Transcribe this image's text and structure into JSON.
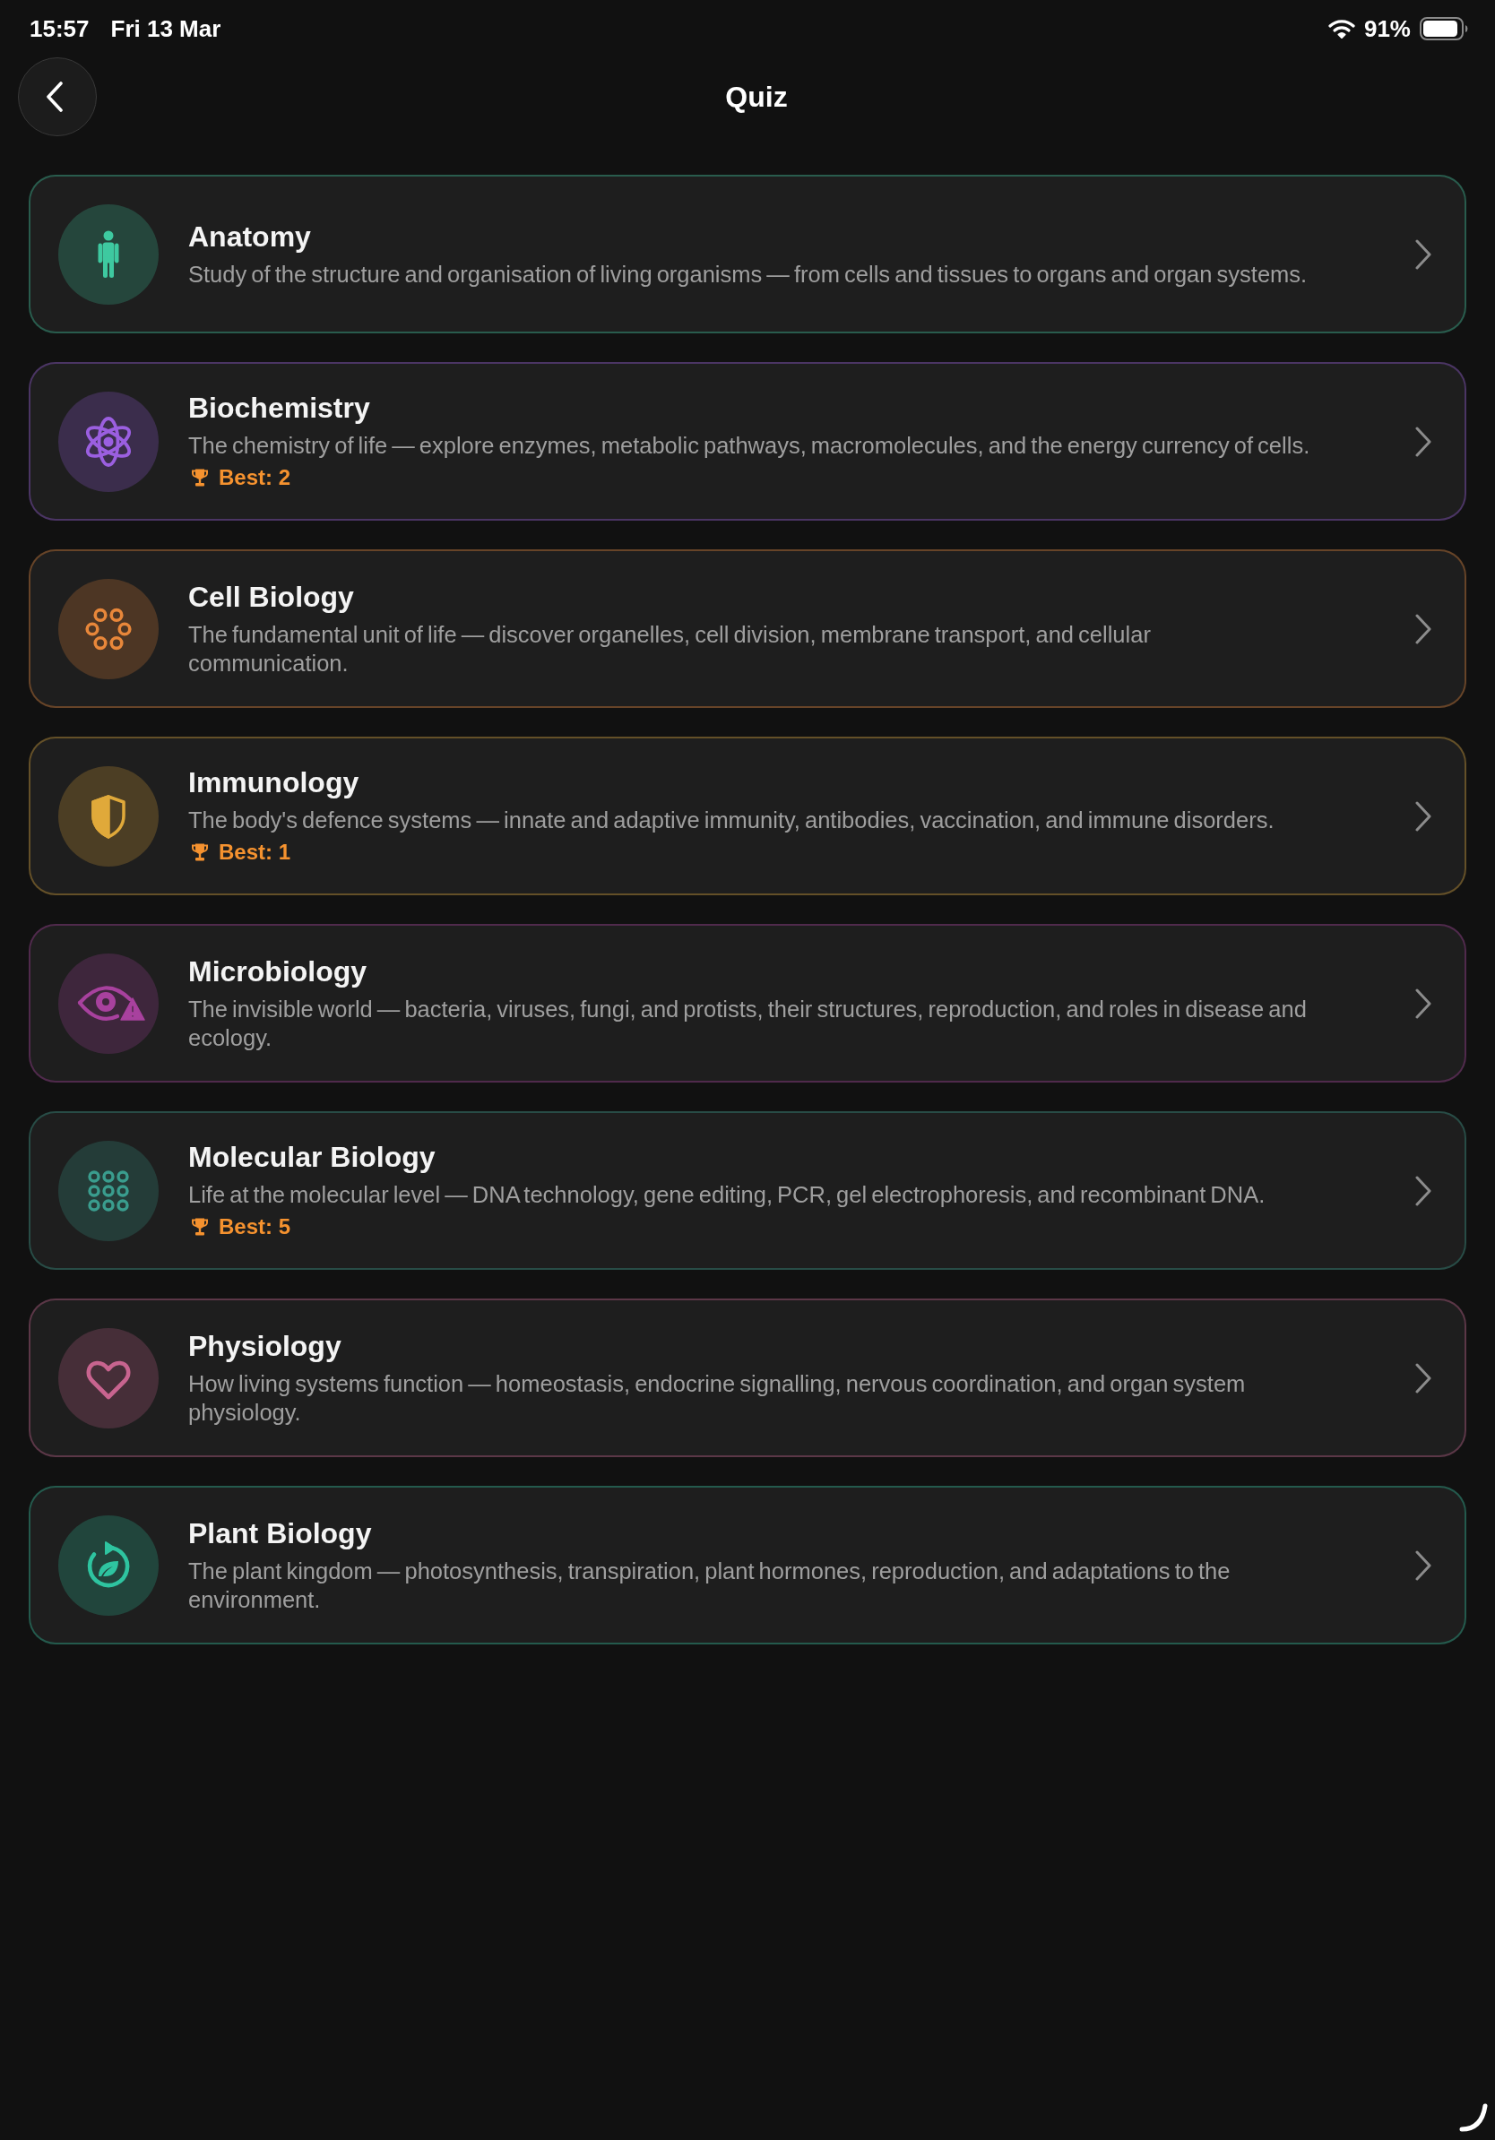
{
  "status_bar": {
    "time": "15:57",
    "date": "Fri 13 Mar",
    "battery_percent": "91%"
  },
  "header": {
    "title": "Quiz"
  },
  "topics": [
    {
      "title": "Anatomy",
      "description": "Study of the structure and organisation of living organisms — from cells and tissues to organs and organ systems.",
      "color": "#3ec9a0"
    },
    {
      "title": "Biochemistry",
      "description": "The chemistry of life — explore enzymes, metabolic pathways, macromolecules, and the energy currency of cells.",
      "best": "Best: 2",
      "color": "#9b5fe0"
    },
    {
      "title": "Cell Biology",
      "description": "The fundamental unit of life — discover organelles, cell division, membrane transport, and cellular communication.",
      "color": "#e8873a"
    },
    {
      "title": "Immunology",
      "description": "The body's defence systems — innate and adaptive immunity, antibodies, vaccination, and immune disorders.",
      "best": "Best: 1",
      "color": "#e0a93a"
    },
    {
      "title": "Microbiology",
      "description": "The invisible world — bacteria, viruses, fungi, and protists, their structures, reproduction, and roles in disease and ecology.",
      "color": "#a8419e"
    },
    {
      "title": "Molecular Biology",
      "description": "Life at the molecular level — DNA technology, gene editing, PCR, gel electrophoresis, and recombinant DNA.",
      "best": "Best: 5",
      "color": "#3a9d8e"
    },
    {
      "title": "Physiology",
      "description": "How living systems function — homeostasis, endocrine signalling, nervous coordination, and organ system physiology.",
      "color": "#c8648f"
    },
    {
      "title": "Plant Biology",
      "description": "The plant kingdom — photosynthesis, transpiration, plant hormones, reproduction, and adaptations to the environment.",
      "color": "#2ec4a0"
    }
  ]
}
